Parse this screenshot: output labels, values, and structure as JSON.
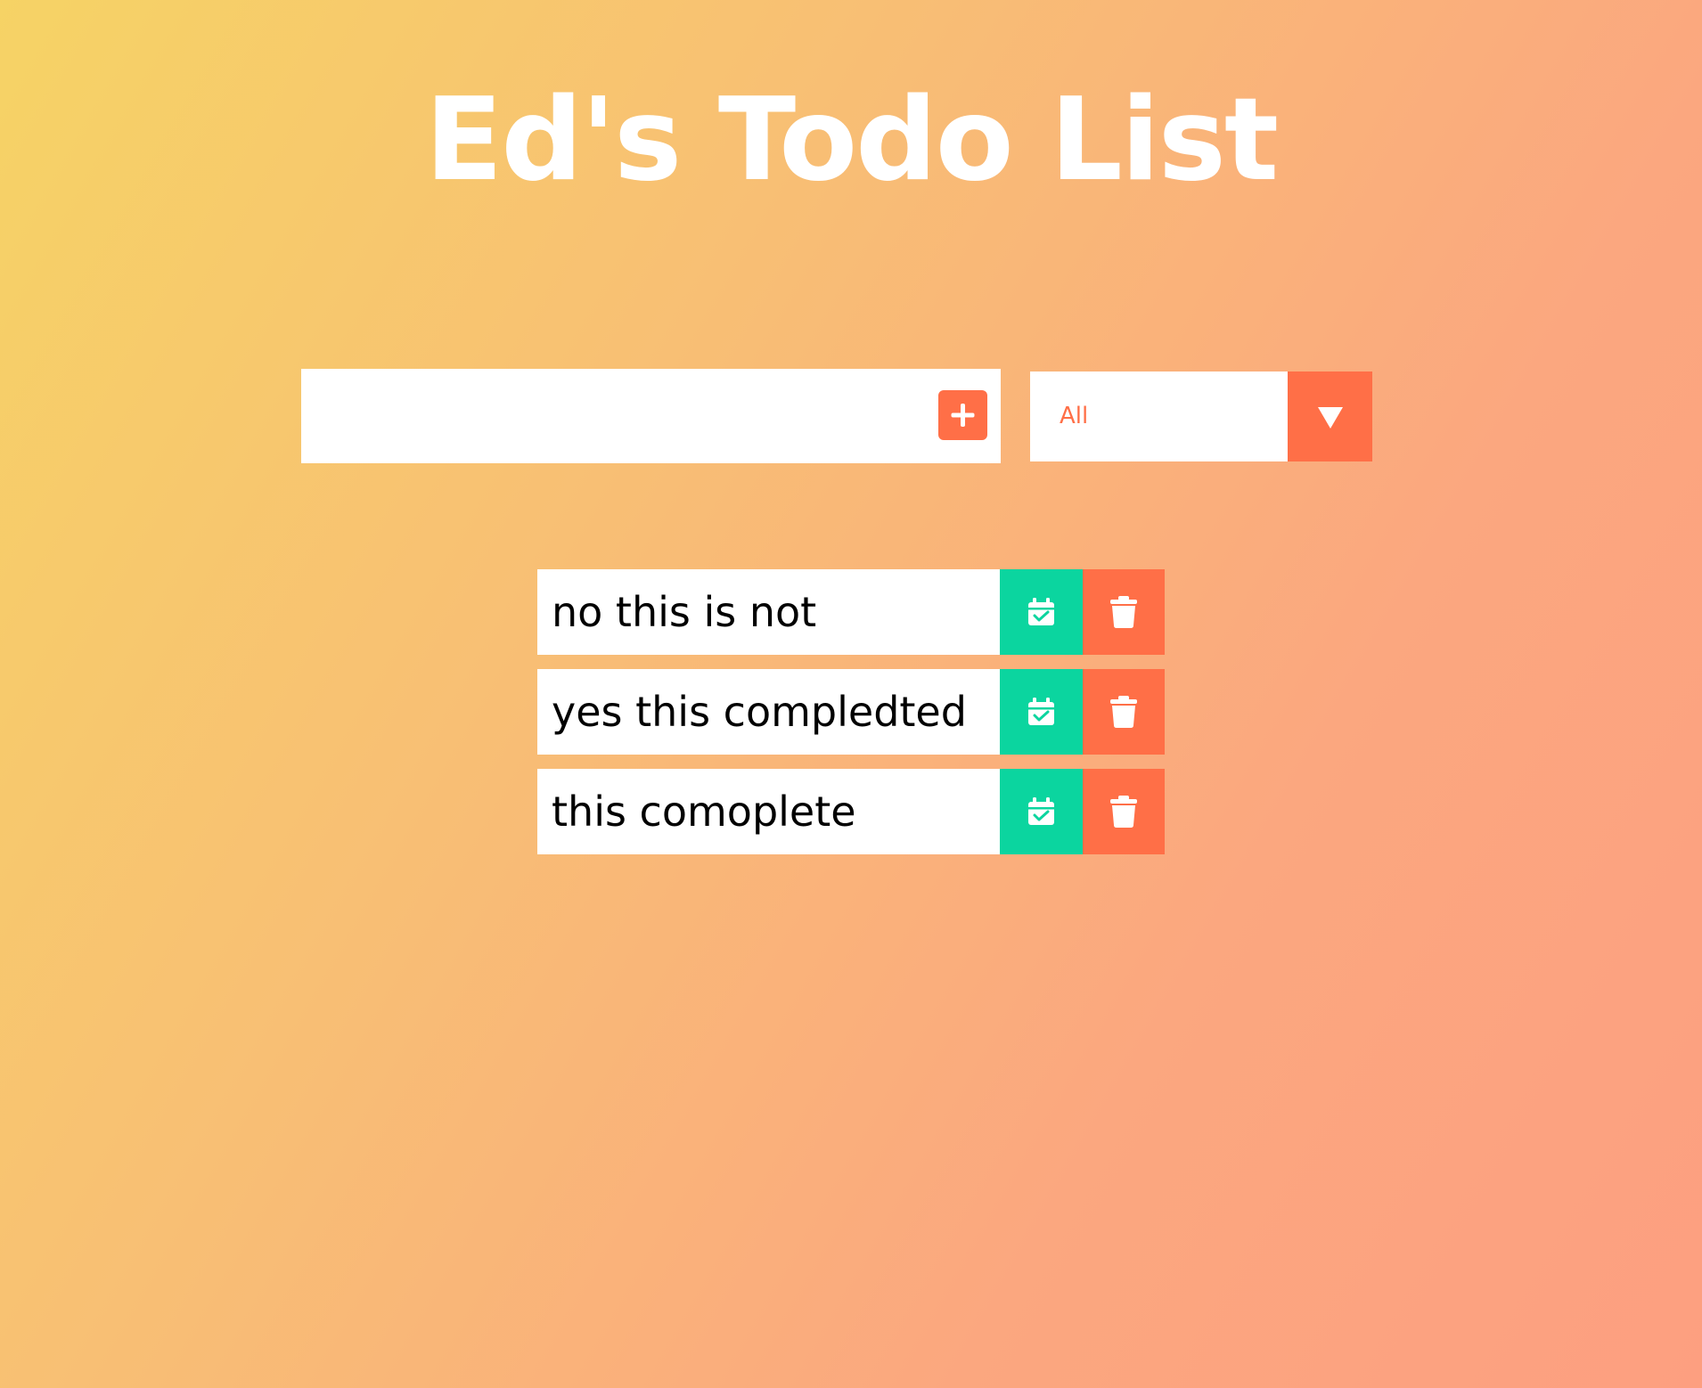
{
  "header": {
    "title": "Ed's Todo List"
  },
  "form": {
    "input_value": "",
    "add_icon": "plus-icon",
    "filter_selected": "All",
    "filter_icon": "triangle-down-icon"
  },
  "todos": [
    {
      "text": "no this is not",
      "complete_icon": "calendar-check-icon",
      "delete_icon": "trash-icon"
    },
    {
      "text": "yes this compledted",
      "complete_icon": "calendar-check-icon",
      "delete_icon": "trash-icon"
    },
    {
      "text": "this comoplete",
      "complete_icon": "calendar-check-icon",
      "delete_icon": "trash-icon"
    }
  ],
  "colors": {
    "accent": "#ff6f47",
    "complete": "#0bd59f",
    "background_start": "#f6d365",
    "background_end": "#fd9f80"
  }
}
